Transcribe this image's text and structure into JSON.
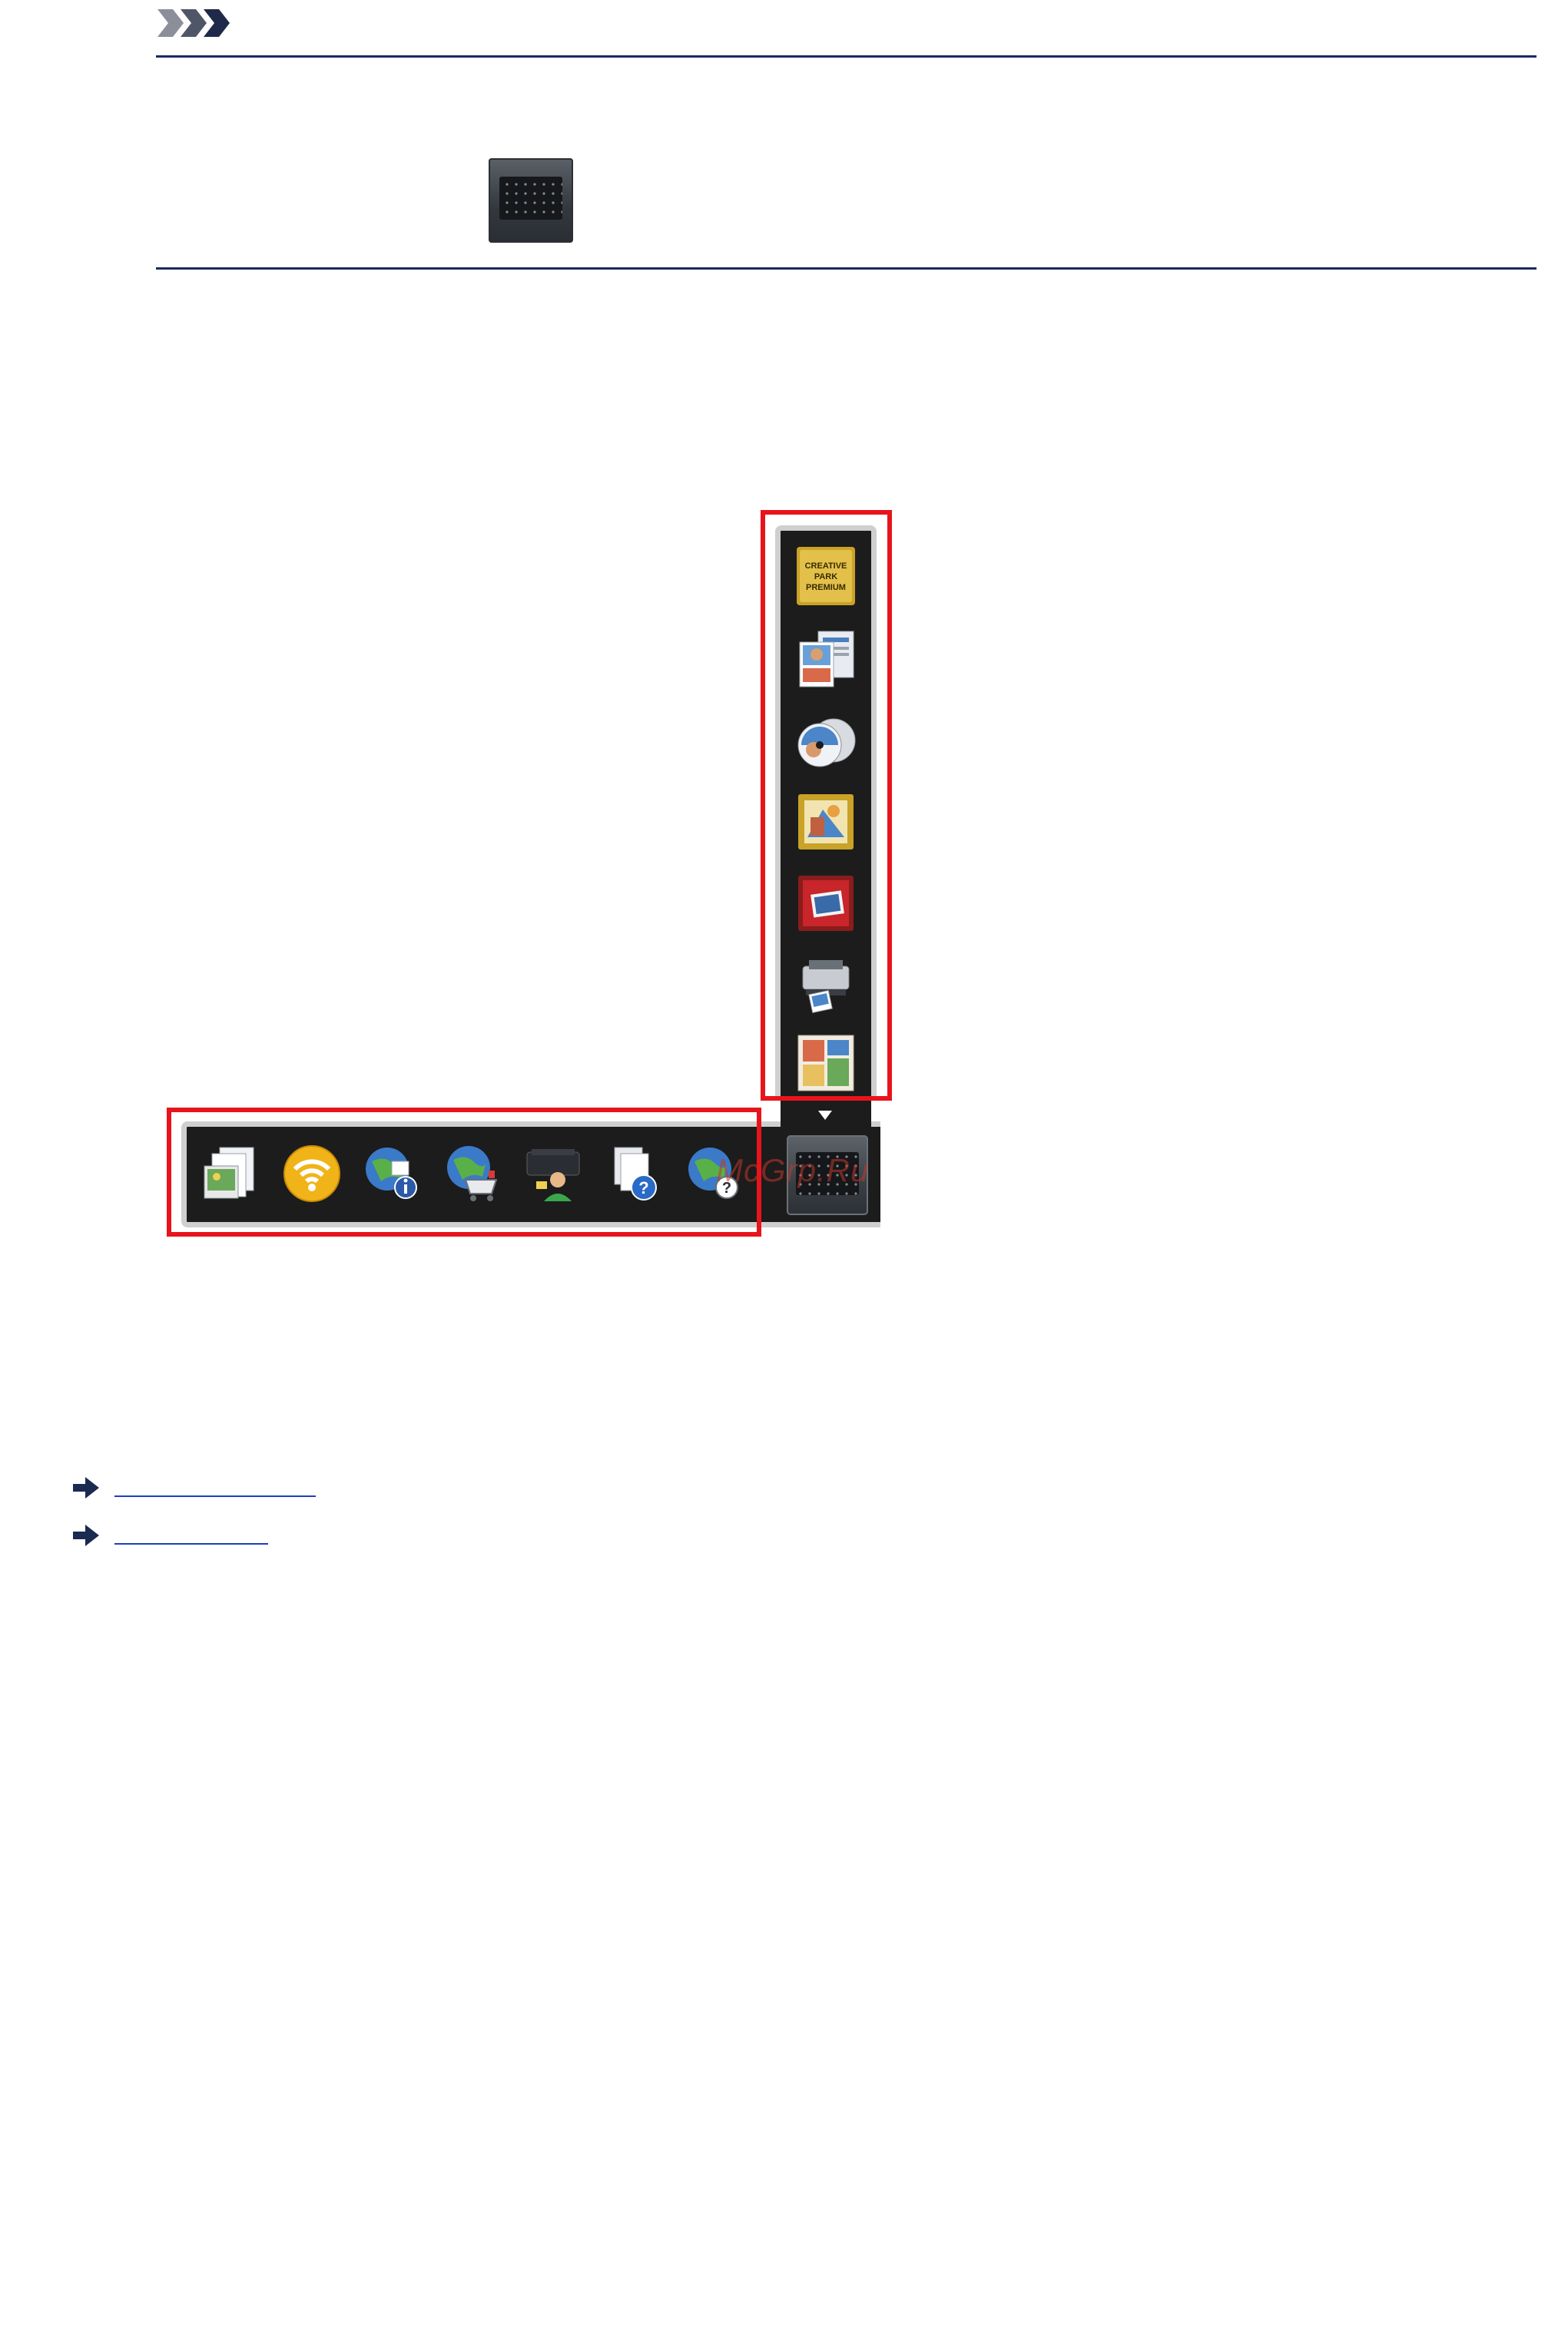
{
  "note": {
    "header_icon": "note-chevrons-icon",
    "inline_icon": "quick-menu-main-icon"
  },
  "dock": {
    "watermark": "McGrp.Ru",
    "vertical_icons": [
      {
        "icon": "creative-park-premium-icon",
        "label": "CREATIVE PARK PREMIUM"
      },
      {
        "icon": "photo-layout-icon"
      },
      {
        "icon": "disc-label-icon"
      },
      {
        "icon": "photo-print-icon"
      },
      {
        "icon": "red-photo-album-icon"
      },
      {
        "icon": "printer-photo-icon"
      },
      {
        "icon": "photo-collage-icon"
      }
    ],
    "horizontal_icons": [
      {
        "icon": "scan-documents-icon"
      },
      {
        "icon": "wireless-wifi-icon"
      },
      {
        "icon": "globe-info-icon"
      },
      {
        "icon": "globe-shopping-icon"
      },
      {
        "icon": "printer-user-icon"
      },
      {
        "icon": "documents-help-icon"
      },
      {
        "icon": "globe-help-icon"
      }
    ],
    "expand_icon": "triangle-down-icon",
    "main_button_icon": "quick-menu-main-icon"
  },
  "links": [
    {
      "icon": "arrow-right-icon"
    },
    {
      "icon": "arrow-right-icon"
    }
  ]
}
